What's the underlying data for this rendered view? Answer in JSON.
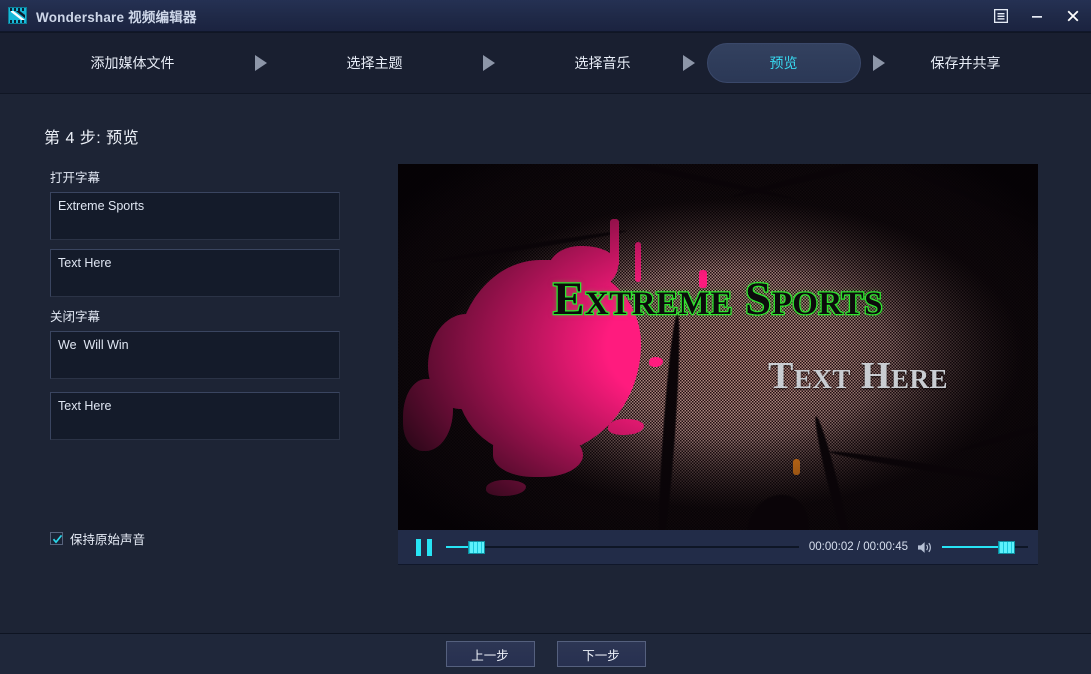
{
  "window": {
    "title": "Wondershare 视频编辑器",
    "logo_icon": "film-strip-icon",
    "controls": [
      {
        "name": "menu-button",
        "icon": "list-menu-icon"
      },
      {
        "name": "minimize-button",
        "icon": "minimize-icon"
      },
      {
        "name": "close-button",
        "icon": "close-icon"
      }
    ]
  },
  "stepnav": {
    "steps": [
      {
        "label": "添加媒体文件",
        "active": false
      },
      {
        "label": "选择主题",
        "active": false
      },
      {
        "label": "选择音乐",
        "active": false
      },
      {
        "label": "预览",
        "active": true
      },
      {
        "label": "保存并共享",
        "active": false
      }
    ],
    "arrow_icon": "triangle-right-icon",
    "active_color": "#38d8ef"
  },
  "page": {
    "title": "第 4 步: 预览"
  },
  "left_panel": {
    "open_caption_label": "打开字幕",
    "open_caption_line1": "Extreme Sports",
    "open_caption_line2": "Text Here",
    "close_caption_label": "关闭字幕",
    "close_caption_line1": "We  Will Win",
    "close_caption_line2": "Text Here",
    "keep_audio_label": "保持原始声音",
    "keep_audio_checked": true,
    "check_color": "#2ad7ea"
  },
  "preview": {
    "overlay_title": "Extreme Sports",
    "overlay_subtitle": "Text Here",
    "title_color": "#2fe62f",
    "subtitle_color": "#c9cdd2"
  },
  "player": {
    "play_state_icon": "pause-icon",
    "current_time": "00:00:02",
    "total_time": "00:00:45",
    "time_display": "00:00:02 / 00:00:45",
    "progress_percent": 4,
    "volume_percent": 88,
    "volume_icon": "speaker-on-icon",
    "accent_color": "#27e4f5"
  },
  "footer": {
    "prev_label": "上一步",
    "next_label": "下一步"
  }
}
